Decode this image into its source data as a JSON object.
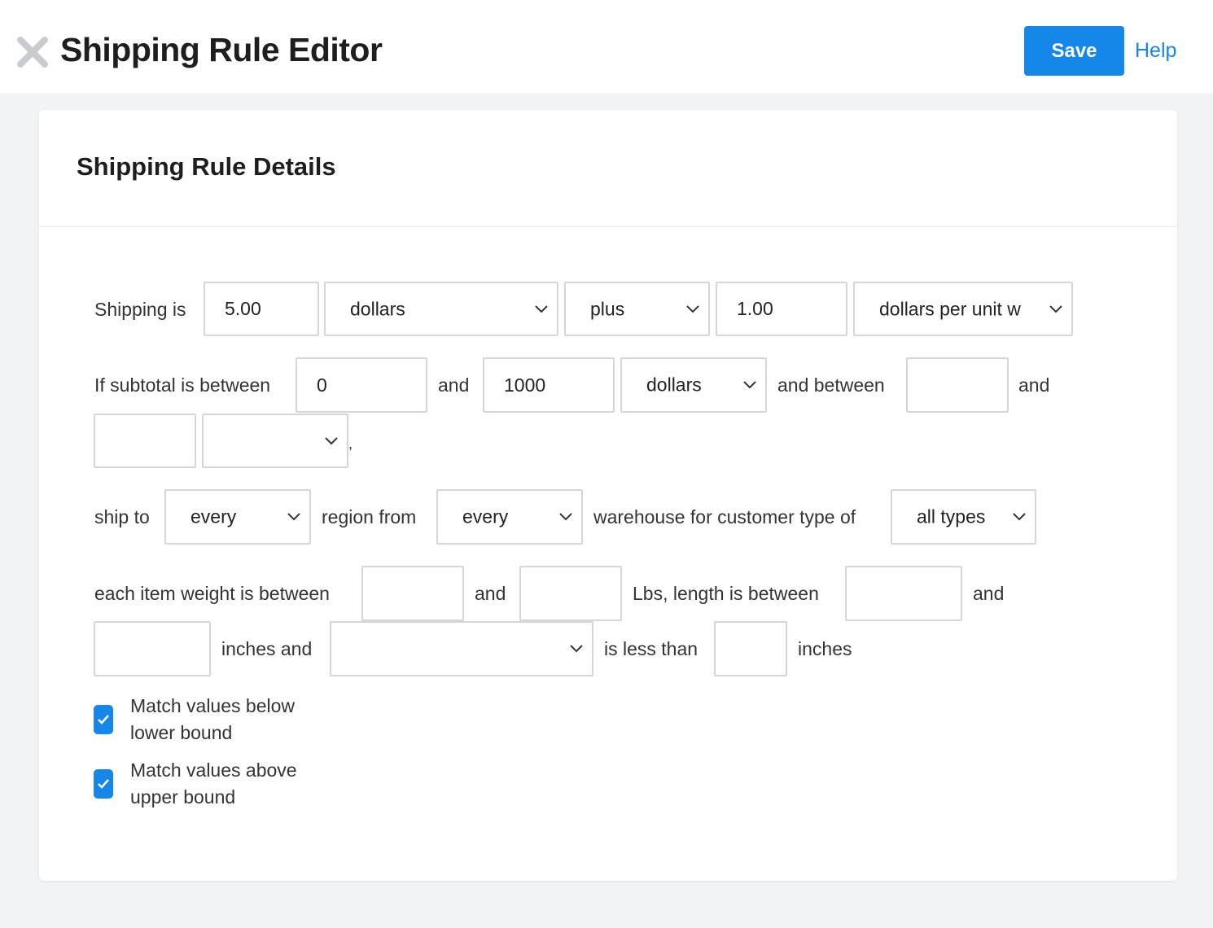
{
  "header": {
    "title": "Shipping Rule Editor",
    "save_label": "Save",
    "help_label": "Help",
    "close_icon": "close-icon",
    "accent_color": "#1487e8"
  },
  "card": {
    "title": "Shipping Rule Details"
  },
  "row1": {
    "label_shipping_is": "Shipping is",
    "base_amount": "5.00",
    "base_unit": "dollars",
    "operator": "plus",
    "per_amount": "1.00",
    "per_unit": "dollars per unit w"
  },
  "row2": {
    "label_if_subtotal": "If subtotal is between",
    "subtotal_min": "0",
    "label_and_1": "and",
    "subtotal_max": "1000",
    "subtotal_unit": "dollars",
    "label_and_between": "and between",
    "extra_min": "",
    "label_and_2": "and",
    "extra_max": "",
    "extra_unit": "",
    "comma": ","
  },
  "row3": {
    "label_ship_to": "ship to",
    "region": "every",
    "label_region_from": "region from",
    "warehouse": "every",
    "label_warehouse_for": "warehouse for customer type of",
    "customer_type": "all types"
  },
  "row4": {
    "label_weight": "each item weight is between",
    "weight_min": "",
    "label_and_1": "and",
    "weight_max": "",
    "label_lbs_length": "Lbs, length is between",
    "length_min": "",
    "label_and_2": "and",
    "length_max": "",
    "label_inches_and": "inches and",
    "dimension_select": "",
    "label_less_than": "is less than",
    "dimension_value": "",
    "label_inches": "inches"
  },
  "options": {
    "match_below_label": "Match values below lower bound",
    "match_below_checked": true,
    "match_above_label": "Match values above upper bound",
    "match_above_checked": true
  }
}
